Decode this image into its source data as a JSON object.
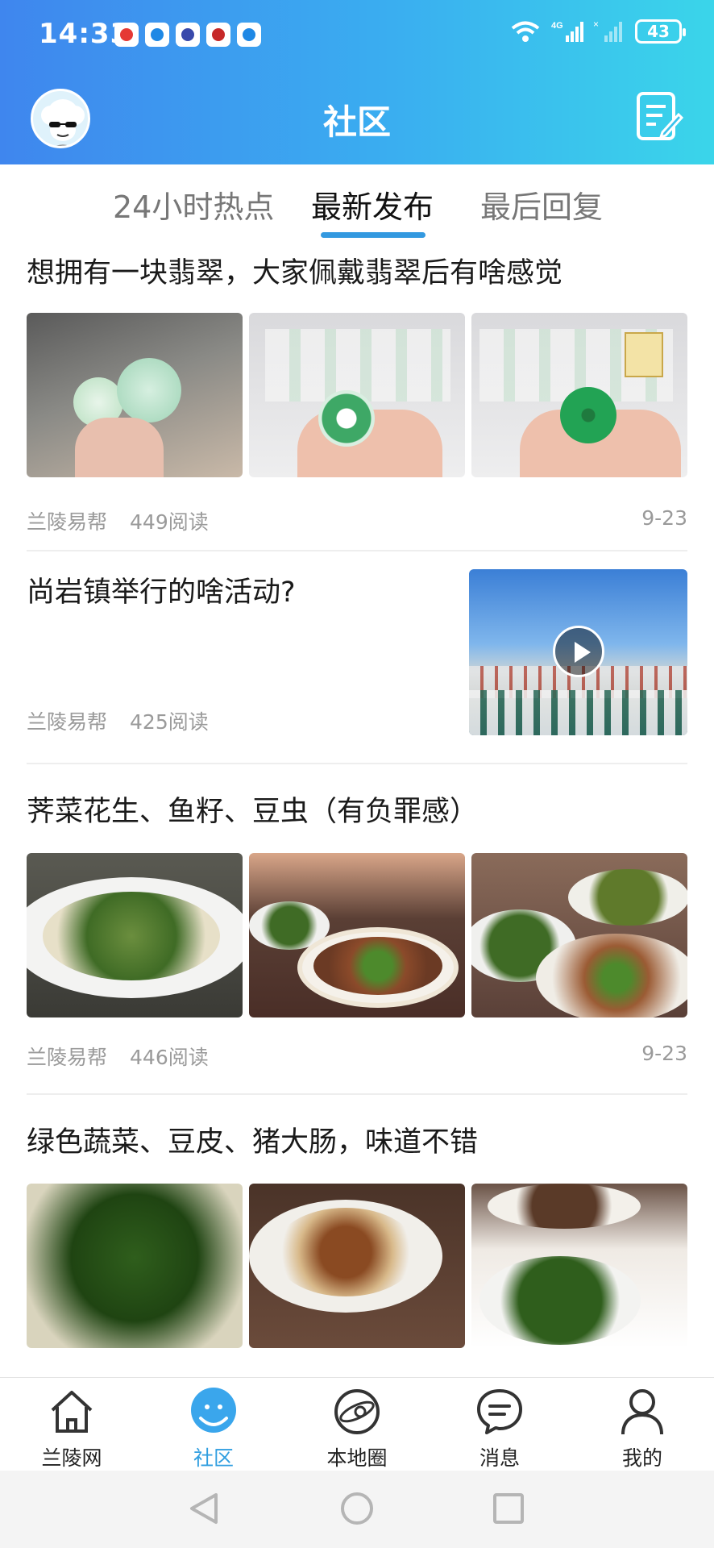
{
  "status_bar": {
    "time": "14:33",
    "network": "4G",
    "battery": "43"
  },
  "header": {
    "title": "社区"
  },
  "tabs": [
    {
      "label": "24小时热点",
      "active": false
    },
    {
      "label": "最新发布",
      "active": true
    },
    {
      "label": "最后回复",
      "active": false
    }
  ],
  "posts": [
    {
      "title": "想拥有一块翡翠，大家佩戴翡翠后有啥感觉",
      "author": "兰陵易帮",
      "reads": "449阅读",
      "date": "9-23"
    },
    {
      "title": "尚岩镇举行的啥活动?",
      "author": "兰陵易帮",
      "reads": "425阅读",
      "date": ""
    },
    {
      "title": "荠菜花生、鱼籽、豆虫（有负罪感）",
      "author": "兰陵易帮",
      "reads": "446阅读",
      "date": "9-23"
    },
    {
      "title": "绿色蔬菜、豆皮、猪大肠，味道不错",
      "author": "",
      "reads": "",
      "date": ""
    }
  ],
  "bottom_nav": [
    {
      "label": "兰陵网",
      "icon": "home-icon",
      "active": false
    },
    {
      "label": "社区",
      "icon": "community-icon",
      "active": true
    },
    {
      "label": "本地圈",
      "icon": "planet-icon",
      "active": false
    },
    {
      "label": "消息",
      "icon": "message-icon",
      "active": false
    },
    {
      "label": "我的",
      "icon": "profile-icon",
      "active": false
    }
  ],
  "colors": {
    "header_start": "#3f86ee",
    "header_end": "#3ad5ea",
    "accent": "#2f9ee0"
  }
}
